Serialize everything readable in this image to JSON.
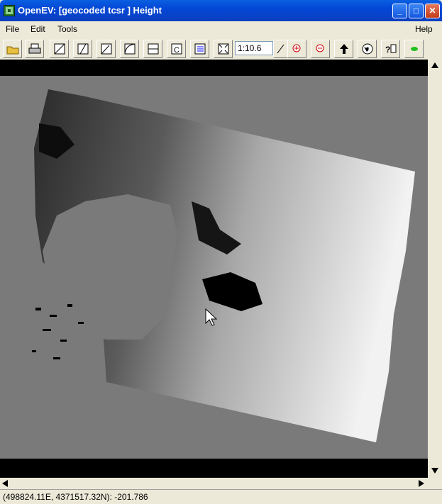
{
  "window": {
    "title": "OpenEV: [geocoded tcsr ] Height"
  },
  "title_buttons": {
    "minimize": "_",
    "maximize": "□",
    "close": "✕"
  },
  "menu": {
    "file": "File",
    "edit": "Edit",
    "tools": "Tools",
    "help": "Help"
  },
  "toolbar": {
    "zoom_value": "1:10.6",
    "icons": [
      "open-folder-icon",
      "print-icon",
      "stretch-linear-icon",
      "stretch-a-icon",
      "stretch-b-icon",
      "stretch-curve-icon",
      "gcp-icon",
      "classify-icon",
      "legend-list-icon",
      "fit-extent-icon",
      "zoom-slider-icon",
      "zoom-in-icon",
      "zoom-out-icon",
      "up-arrow-icon",
      "globe-icon",
      "help-query-icon",
      "green-indicator-icon"
    ]
  },
  "status": {
    "coords": "(498824.11E, 4371517.32N): -201.786"
  },
  "colors": {
    "titlebar": "#0347d6",
    "chrome": "#ece9d8",
    "canvas_bg": "#7a7a7a"
  }
}
